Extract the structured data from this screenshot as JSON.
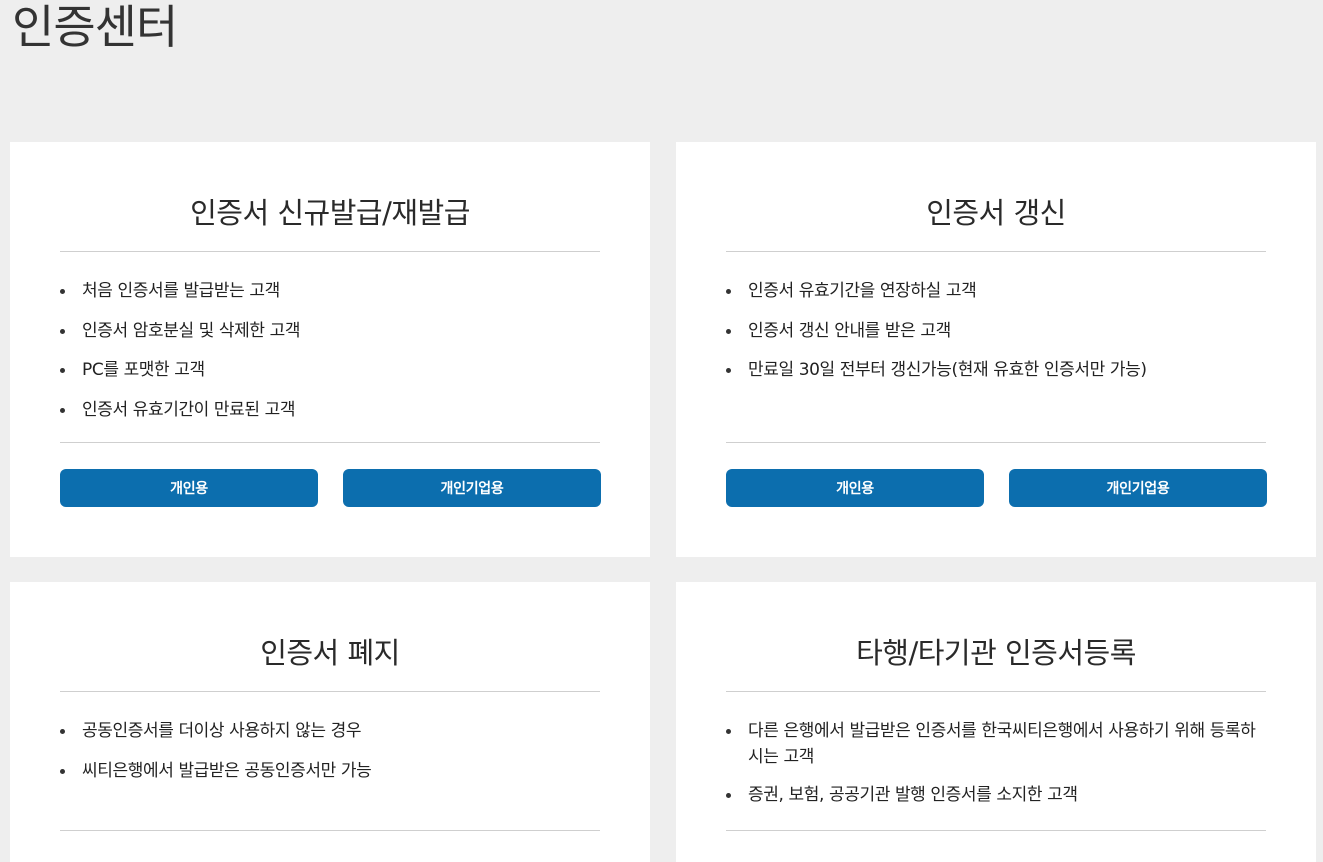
{
  "page": {
    "title": "인증센터"
  },
  "colors": {
    "background": "#eeeeee",
    "card": "#ffffff",
    "button": "#0c6eae",
    "button_text": "#ffffff"
  },
  "cards": [
    {
      "title": "인증서 신규발급/재발급",
      "items": [
        "처음 인증서를 발급받는 고객",
        "인증서 암호분실 및 삭제한 고객",
        "PC를 포맷한 고객",
        "인증서 유효기간이 만료된 고객"
      ],
      "buttons": [
        "개인용",
        "개인기업용"
      ]
    },
    {
      "title": "인증서 갱신",
      "items": [
        "인증서 유효기간을 연장하실 고객",
        "인증서 갱신 안내를 받은 고객",
        "만료일 30일 전부터 갱신가능(현재 유효한 인증서만 가능)"
      ],
      "buttons": [
        "개인용",
        "개인기업용"
      ]
    },
    {
      "title": "인증서 폐지",
      "items": [
        "공동인증서를 더이상 사용하지 않는 경우",
        "씨티은행에서 발급받은 공동인증서만 가능"
      ]
    },
    {
      "title": "타행/타기관 인증서등록",
      "items": [
        "다른 은행에서 발급받은 인증서를 한국씨티은행에서 사용하기 위해 등록하시는 고객",
        "증권, 보험, 공공기관 발행 인증서를 소지한 고객"
      ]
    }
  ]
}
